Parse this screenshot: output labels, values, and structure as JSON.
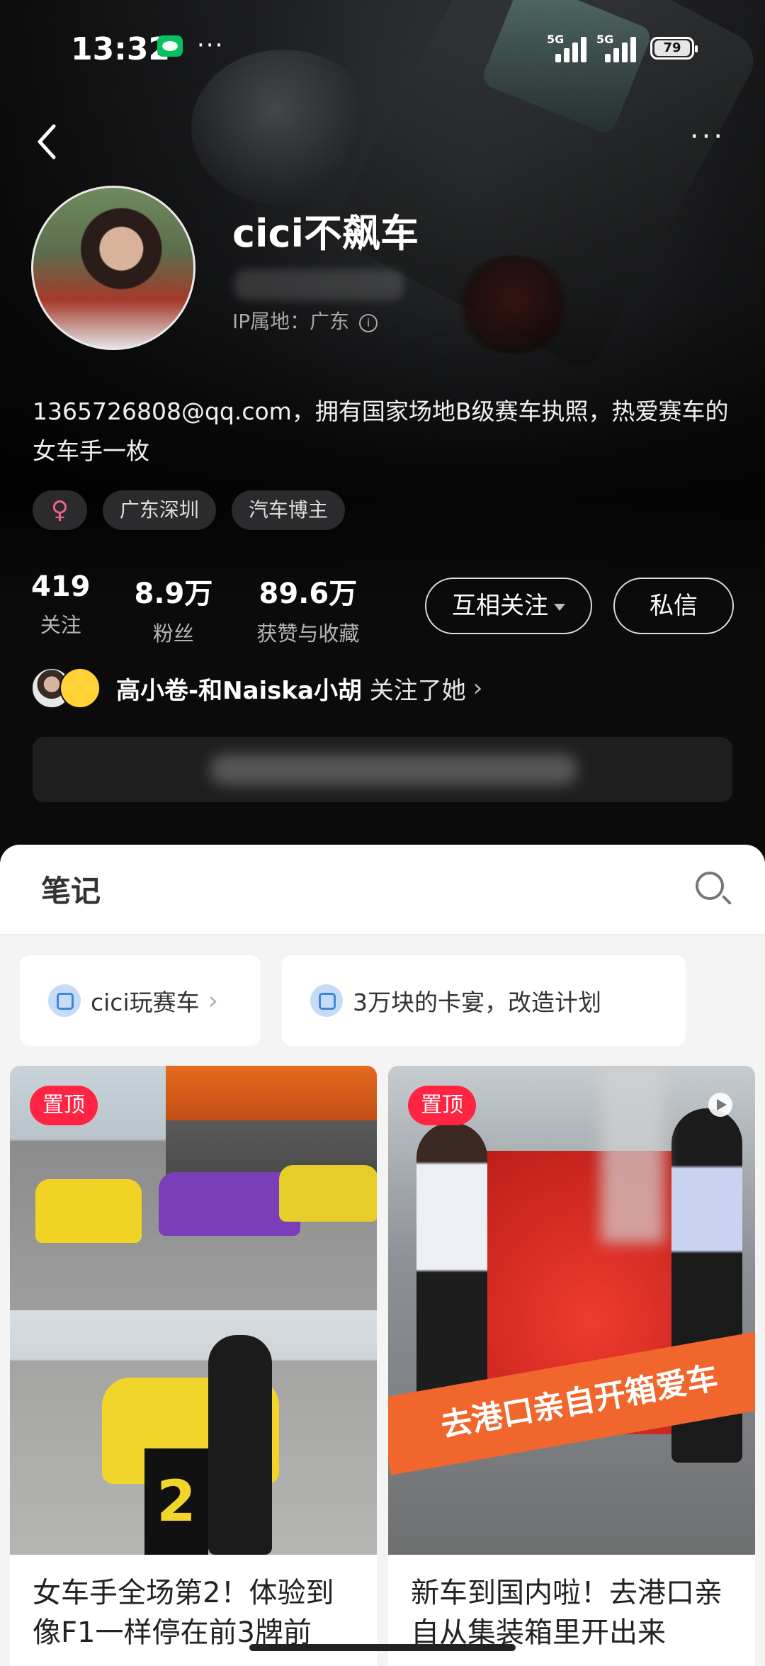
{
  "status_bar": {
    "time": "13:32",
    "signal1": "5G",
    "signal2": "5G",
    "battery": "79"
  },
  "profile": {
    "username": "cici不飙车",
    "ip_location": "IP属地：广东",
    "bio": "1365726808@qq.com，拥有国家场地B级赛车执照，热爱赛车的女车手一枚",
    "tags": [
      "♀",
      "广东深圳",
      "汽车博主"
    ],
    "stats": [
      {
        "value": "419",
        "label": "关注"
      },
      {
        "value": "8.9万",
        "label": "粉丝"
      },
      {
        "value": "89.6万",
        "label": "获赞与收藏"
      }
    ],
    "follow_button": "互相关注",
    "message_button": "私信",
    "mutual": {
      "names": "高小卷-和Naiska小胡",
      "suffix": "关注了她"
    }
  },
  "content": {
    "tab_title": "笔记",
    "collections": [
      "cici玩赛车",
      "3万块的卡宴，改造计划"
    ],
    "notes": [
      {
        "pin": "置顶",
        "title": "女车手全场第2！体验到像F1一样停在前3牌前",
        "board_number": "2"
      },
      {
        "pin": "置顶",
        "title": "新车到国内啦！去港口亲自从集装箱里开出来",
        "banner": "去港口亲自开箱爱车"
      }
    ]
  },
  "colors": {
    "accent": "#ff2442",
    "banner": "#f0662d",
    "collection_icon": "#3e86d9"
  }
}
